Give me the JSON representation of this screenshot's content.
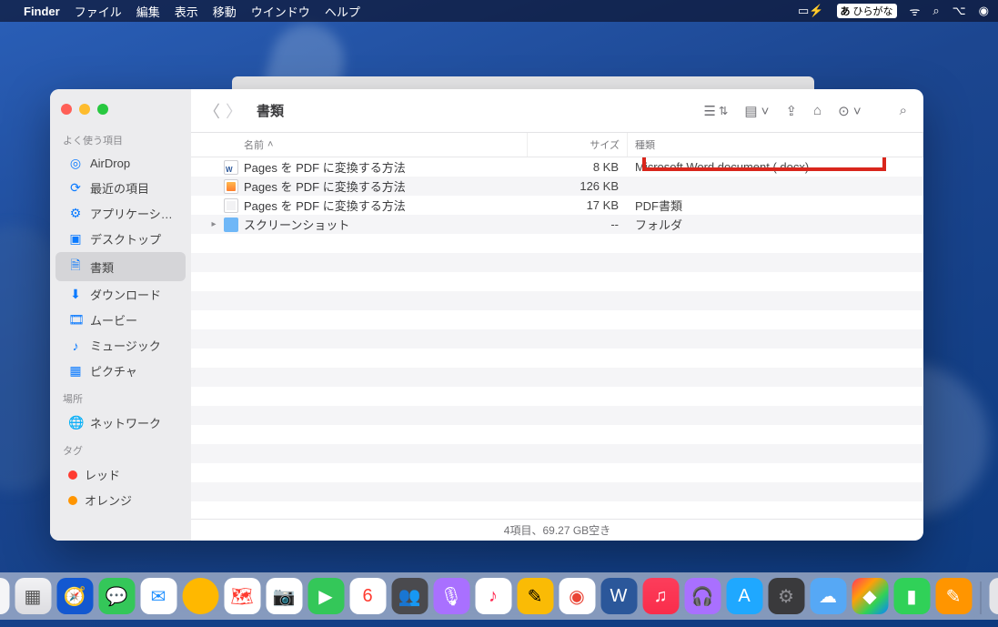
{
  "menubar": {
    "app": "Finder",
    "items": [
      "ファイル",
      "編集",
      "表示",
      "移動",
      "ウインドウ",
      "ヘルプ"
    ],
    "ime_badge": "あ",
    "ime_label": "ひらがな"
  },
  "window": {
    "title": "書類",
    "columns": {
      "name": "名前",
      "size": "サイズ",
      "kind": "種類"
    },
    "status": "4項目、69.27 GB空き"
  },
  "sidebar": {
    "sections": [
      {
        "label": "よく使う項目",
        "items": [
          {
            "icon": "airdrop",
            "text": "AirDrop"
          },
          {
            "icon": "clock",
            "text": "最近の項目"
          },
          {
            "icon": "apps",
            "text": "アプリケーシ…"
          },
          {
            "icon": "desktop",
            "text": "デスクトップ"
          },
          {
            "icon": "doc",
            "text": "書類",
            "selected": true
          },
          {
            "icon": "down",
            "text": "ダウンロード"
          },
          {
            "icon": "movie",
            "text": "ムービー"
          },
          {
            "icon": "music",
            "text": "ミュージック"
          },
          {
            "icon": "picture",
            "text": "ピクチャ"
          }
        ]
      },
      {
        "label": "場所",
        "items": [
          {
            "icon": "globe",
            "text": "ネットワーク",
            "net": true
          }
        ]
      },
      {
        "label": "タグ",
        "items": [
          {
            "tag": "#ff3b30",
            "text": "レッド"
          },
          {
            "tag": "#ff9500",
            "text": "オレンジ"
          }
        ]
      }
    ]
  },
  "files": [
    {
      "icon": "word",
      "name": "Pages を PDF に変換する方法",
      "size": "8 KB",
      "kind": "Microsoft Word document (.docx)",
      "highlight": true
    },
    {
      "icon": "pages",
      "name": "Pages を PDF に変換する方法",
      "size": "126 KB",
      "kind": ""
    },
    {
      "icon": "pdf",
      "name": "Pages を PDF に変換する方法",
      "size": "17 KB",
      "kind": "PDF書類"
    },
    {
      "icon": "folder",
      "name": "スクリーンショット",
      "size": "--",
      "kind": "フォルダ",
      "disclosure": true
    }
  ],
  "dock": [
    {
      "bg": "#f5f5f7",
      "fg": "#0a7aff",
      "glyph": "☺"
    },
    {
      "bg": "linear-gradient(#f2f2f4,#dcdce0)",
      "fg": "#555",
      "glyph": "▦"
    },
    {
      "bg": "#1358d0",
      "fg": "#fff",
      "glyph": "🧭"
    },
    {
      "bg": "#34c759",
      "fg": "#fff",
      "glyph": "💬"
    },
    {
      "bg": "#fff",
      "fg": "#1e8fff",
      "glyph": "✉"
    },
    {
      "bg": "#ffb800",
      "fg": "#fff",
      "glyph": "�ders",
      "round": true
    },
    {
      "bg": "#fff",
      "fg": "#ff3b30",
      "glyph": "🗺"
    },
    {
      "bg": "#fff",
      "fg": "#0a84ff",
      "glyph": "📷"
    },
    {
      "bg": "#34c759",
      "fg": "#fff",
      "glyph": "▶"
    },
    {
      "bg": "#fff",
      "fg": "#ff3b30",
      "glyph": "📅",
      "badge": "6"
    },
    {
      "bg": "#4a4a4e",
      "fg": "#fff",
      "glyph": "👥"
    },
    {
      "bg": "#a970ff",
      "fg": "#fff",
      "glyph": "🎙"
    },
    {
      "bg": "#fff",
      "fg": "#ff2d55",
      "glyph": "♪"
    },
    {
      "bg": "#fabb05",
      "fg": "#000",
      "glyph": "✎"
    },
    {
      "bg": "#fff",
      "fg": "#ea4335",
      "glyph": "◉"
    },
    {
      "bg": "#2b579a",
      "fg": "#fff",
      "glyph": "W"
    },
    {
      "bg": "linear-gradient(#fc3d5b,#fa2d4b)",
      "fg": "#fff",
      "glyph": "♫"
    },
    {
      "bg": "#a970ff",
      "fg": "#fff",
      "glyph": "🎧"
    },
    {
      "bg": "#1fa8ff",
      "fg": "#fff",
      "glyph": "A"
    },
    {
      "bg": "#3a3a3c",
      "fg": "#8e8e93",
      "glyph": "⚙"
    },
    {
      "bg": "#56a8f5",
      "fg": "#fff",
      "glyph": "☁"
    },
    {
      "bg": "linear-gradient(135deg,#ff375f,#ff9f0a,#30d158,#0a84ff)",
      "fg": "#fff",
      "glyph": "◆"
    },
    {
      "bg": "#30d158",
      "fg": "#fff",
      "glyph": "▮"
    },
    {
      "bg": "#ff9500",
      "fg": "#fff",
      "glyph": "✎"
    }
  ],
  "trash_glyph": "🗑"
}
